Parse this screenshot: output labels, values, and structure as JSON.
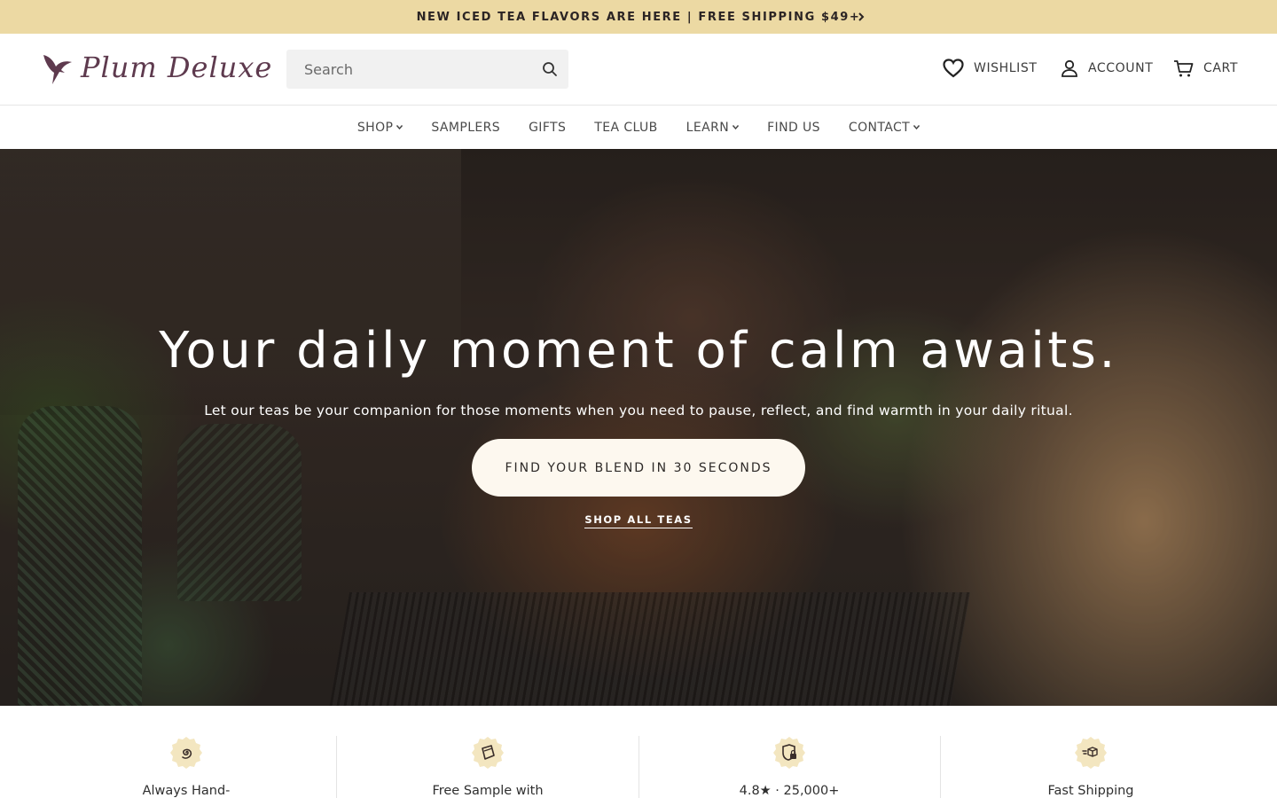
{
  "announcement": {
    "text": "NEW ICED TEA FLAVORS ARE HERE | FREE SHIPPING $49+",
    "arrow_icon": "chevron-right-icon"
  },
  "header": {
    "logo_text": "Plum Deluxe",
    "search_placeholder": "Search",
    "wishlist_label": "WISHLIST",
    "account_label": "ACCOUNT",
    "cart_label": "CART"
  },
  "nav": {
    "items": [
      {
        "label": "SHOP",
        "dropdown": true
      },
      {
        "label": "SAMPLERS",
        "dropdown": false
      },
      {
        "label": "GIFTS",
        "dropdown": false
      },
      {
        "label": "TEA CLUB",
        "dropdown": false
      },
      {
        "label": "LEARN",
        "dropdown": true
      },
      {
        "label": "FIND US",
        "dropdown": false
      },
      {
        "label": "CONTACT",
        "dropdown": true
      }
    ]
  },
  "hero": {
    "title": "Your daily moment of calm awaits.",
    "subtitle": "Let our teas be your companion for those moments when you need to pause, reflect, and find warmth in your daily ritual.",
    "cta_label": "FIND YOUR BLEND IN 30 SECONDS",
    "link_label": "SHOP ALL TEAS"
  },
  "features": [
    {
      "label": "Always Hand-",
      "icon": "swirl-icon"
    },
    {
      "label": "Free Sample with",
      "icon": "tea-sample-icon"
    },
    {
      "label": "4.8★ · 25,000+",
      "icon": "shield-lock-icon"
    },
    {
      "label": "Fast Shipping",
      "icon": "shipping-box-icon"
    }
  ],
  "colors": {
    "announcement_bg": "#ecd9a3",
    "brand_plum": "#5e3a4e",
    "cta_bg": "#fdf8ef",
    "badge_bg": "#f3e6c0"
  }
}
